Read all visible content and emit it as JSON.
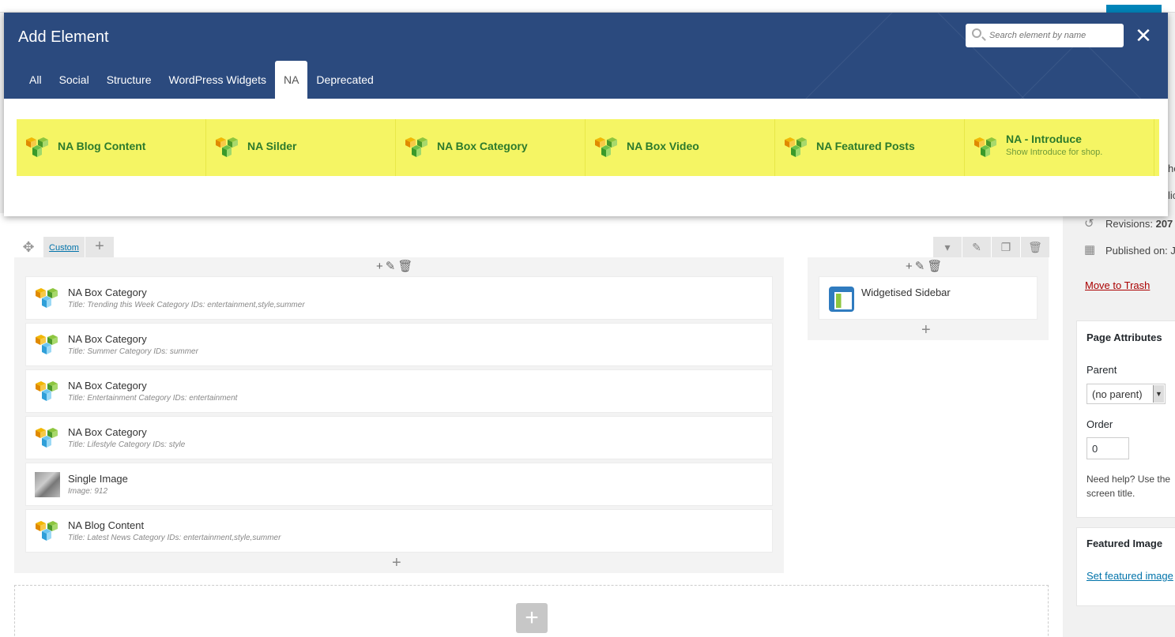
{
  "modal": {
    "title": "Add Element",
    "search_placeholder": "Search element by name",
    "close_label": "✕",
    "tabs": [
      {
        "label": "All"
      },
      {
        "label": "Social"
      },
      {
        "label": "Structure"
      },
      {
        "label": "WordPress Widgets"
      },
      {
        "label": "NA",
        "active": true
      },
      {
        "label": "Deprecated"
      }
    ],
    "elements": [
      {
        "title": "NA Blog Content",
        "subtitle": ""
      },
      {
        "title": "NA Silder",
        "subtitle": ""
      },
      {
        "title": "NA Box Category",
        "subtitle": ""
      },
      {
        "title": "NA Box Video",
        "subtitle": ""
      },
      {
        "title": "NA Featured Posts",
        "subtitle": ""
      },
      {
        "title": "NA - Introduce",
        "subtitle": "Show Introduce for shop."
      }
    ]
  },
  "builder": {
    "row_tab_label": "Custom",
    "left_column": [
      {
        "title": "NA Box Category",
        "subtitle": "Title: Trending this Week  Category IDs: entertainment,style,summer",
        "icon": "vc-logo-icon"
      },
      {
        "title": "NA Box Category",
        "subtitle": "Title: Summer  Category IDs: summer",
        "icon": "vc-logo-icon"
      },
      {
        "title": "NA Box Category",
        "subtitle": "Title: Entertainment  Category IDs: entertainment",
        "icon": "vc-logo-icon"
      },
      {
        "title": "NA Box Category",
        "subtitle": "Title: Lifestyle  Category IDs: style",
        "icon": "vc-logo-icon"
      },
      {
        "title": "Single Image",
        "subtitle": "Image: 912",
        "icon": "image-thumb-icon"
      },
      {
        "title": "NA Blog Content",
        "subtitle": "Title: Latest News  Category IDs: entertainment,style,summer",
        "icon": "vc-logo-icon"
      }
    ],
    "right_column": [
      {
        "title": "Widgetised Sidebar",
        "icon": "widget-sidebar-icon"
      }
    ]
  },
  "sidebar": {
    "revisions_label": "Revisions:",
    "revisions_count": "207",
    "published_label": "Published on: J",
    "move_to_trash": "Move to Trash",
    "page_attributes_title": "Page Attributes",
    "parent_label": "Parent",
    "parent_value": "(no parent)",
    "order_label": "Order",
    "order_value": "0",
    "help_line1": "Need help? Use the",
    "help_line2": "screen title.",
    "featured_image_title": "Featured Image",
    "set_featured_image": "Set featured image",
    "clipped_text_1": "he",
    "clipped_text_2": "lic"
  },
  "colors": {
    "modal_header": "#2b4a7e",
    "highlight": "#f5f564",
    "element_title": "#2c7a2c",
    "link": "#0073aa",
    "trash": "#a00"
  }
}
